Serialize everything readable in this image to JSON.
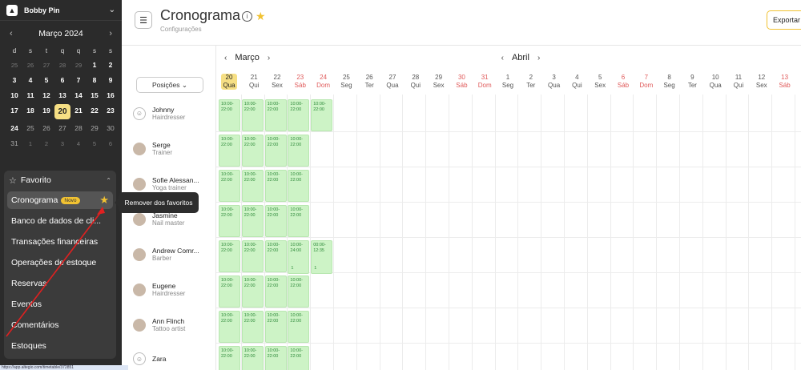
{
  "brand": {
    "name": "Bobby Pin",
    "logo_letter": "▲"
  },
  "calendar": {
    "month": "Março 2024",
    "prev": "‹",
    "next": "›",
    "dow": [
      "d",
      "s",
      "t",
      "q",
      "q",
      "s",
      "s"
    ],
    "weeks": [
      [
        {
          "d": "25",
          "m": 1
        },
        {
          "d": "26",
          "m": 1
        },
        {
          "d": "27",
          "m": 1
        },
        {
          "d": "28",
          "m": 1
        },
        {
          "d": "29",
          "m": 1
        },
        {
          "d": "1",
          "m": 0
        },
        {
          "d": "2",
          "m": 0
        }
      ],
      [
        {
          "d": "3",
          "m": 0
        },
        {
          "d": "4",
          "m": 0
        },
        {
          "d": "5",
          "m": 0
        },
        {
          "d": "6",
          "m": 0
        },
        {
          "d": "7",
          "m": 0
        },
        {
          "d": "8",
          "m": 0
        },
        {
          "d": "9",
          "m": 0
        }
      ],
      [
        {
          "d": "10",
          "m": 0
        },
        {
          "d": "11",
          "m": 0
        },
        {
          "d": "12",
          "m": 0
        },
        {
          "d": "13",
          "m": 0
        },
        {
          "d": "14",
          "m": 0
        },
        {
          "d": "15",
          "m": 0
        },
        {
          "d": "16",
          "m": 0
        }
      ],
      [
        {
          "d": "17",
          "m": 0
        },
        {
          "d": "18",
          "m": 0
        },
        {
          "d": "19",
          "m": 0
        },
        {
          "d": "20",
          "m": 2
        },
        {
          "d": "21",
          "m": 0
        },
        {
          "d": "22",
          "m": 0
        },
        {
          "d": "23",
          "m": 0
        }
      ],
      [
        {
          "d": "24",
          "m": 0
        },
        {
          "d": "25",
          "m": 3
        },
        {
          "d": "26",
          "m": 3
        },
        {
          "d": "27",
          "m": 3
        },
        {
          "d": "28",
          "m": 3
        },
        {
          "d": "29",
          "m": 3
        },
        {
          "d": "30",
          "m": 3
        }
      ],
      [
        {
          "d": "31",
          "m": 3
        },
        {
          "d": "1",
          "m": 1
        },
        {
          "d": "2",
          "m": 1
        },
        {
          "d": "3",
          "m": 1
        },
        {
          "d": "4",
          "m": 1
        },
        {
          "d": "5",
          "m": 1
        },
        {
          "d": "6",
          "m": 1
        }
      ]
    ]
  },
  "favorites": {
    "title": "Favorito",
    "items": [
      {
        "label": "Cronograma",
        "badge": "Novo",
        "active": true
      },
      {
        "label": "Banco de dados de cli..."
      },
      {
        "label": "Transações financeiras"
      },
      {
        "label": "Operações de estoque"
      },
      {
        "label": "Reservas"
      },
      {
        "label": "Eventos"
      },
      {
        "label": "Comentários"
      },
      {
        "label": "Estoques"
      }
    ]
  },
  "tooltip": "Remover dos favoritos",
  "header": {
    "title": "Cronograma",
    "subtitle": "Configurações",
    "export": "Exportar",
    "menu_icon": "☰"
  },
  "schedule": {
    "filter": "Posições",
    "months": [
      {
        "label": "Março",
        "col": 0
      },
      {
        "label": "Abril",
        "col": 12
      }
    ],
    "days": [
      {
        "n": "20",
        "w": "Qua",
        "t": "today"
      },
      {
        "n": "21",
        "w": "Qui",
        "t": "normal"
      },
      {
        "n": "22",
        "w": "Sex",
        "t": "normal"
      },
      {
        "n": "23",
        "w": "Sáb",
        "t": "weekend"
      },
      {
        "n": "24",
        "w": "Dom",
        "t": "weekend"
      },
      {
        "n": "25",
        "w": "Seg",
        "t": "normal"
      },
      {
        "n": "26",
        "w": "Ter",
        "t": "normal"
      },
      {
        "n": "27",
        "w": "Qua",
        "t": "normal"
      },
      {
        "n": "28",
        "w": "Qui",
        "t": "normal"
      },
      {
        "n": "29",
        "w": "Sex",
        "t": "normal"
      },
      {
        "n": "30",
        "w": "Sáb",
        "t": "weekend"
      },
      {
        "n": "31",
        "w": "Dom",
        "t": "weekend"
      },
      {
        "n": "1",
        "w": "Seg",
        "t": "normal"
      },
      {
        "n": "2",
        "w": "Ter",
        "t": "normal"
      },
      {
        "n": "3",
        "w": "Qua",
        "t": "normal"
      },
      {
        "n": "4",
        "w": "Qui",
        "t": "normal"
      },
      {
        "n": "5",
        "w": "Sex",
        "t": "normal"
      },
      {
        "n": "6",
        "w": "Sáb",
        "t": "weekend"
      },
      {
        "n": "7",
        "w": "Dom",
        "t": "weekend"
      },
      {
        "n": "8",
        "w": "Seg",
        "t": "normal"
      },
      {
        "n": "9",
        "w": "Ter",
        "t": "normal"
      },
      {
        "n": "10",
        "w": "Qua",
        "t": "normal"
      },
      {
        "n": "11",
        "w": "Qui",
        "t": "normal"
      },
      {
        "n": "12",
        "w": "Sex",
        "t": "normal"
      },
      {
        "n": "13",
        "w": "Sáb",
        "t": "weekend"
      }
    ],
    "staff": [
      {
        "name": "Johnny",
        "role": "Hairdresser",
        "avatar": "empty",
        "shifts": [
          {
            "c": 0,
            "t": "10:00-\n22:00"
          },
          {
            "c": 1,
            "t": "10:00-\n22:00"
          },
          {
            "c": 2,
            "t": "10:00-\n22:00"
          },
          {
            "c": 3,
            "t": "10:00-\n22:00"
          },
          {
            "c": 4,
            "t": "10:00-\n22:00"
          }
        ]
      },
      {
        "name": "Serge",
        "role": "Trainer",
        "avatar": "photo",
        "shifts": [
          {
            "c": 0,
            "t": "10:00-\n22:00"
          },
          {
            "c": 1,
            "t": "10:00-\n22:00"
          },
          {
            "c": 2,
            "t": "10:00-\n22:00"
          },
          {
            "c": 3,
            "t": "10:00-\n22:00"
          }
        ]
      },
      {
        "name": "Sofie Alessan...",
        "role": "Yoga trainer",
        "avatar": "photo",
        "shifts": [
          {
            "c": 0,
            "t": "10:00-\n22:00"
          },
          {
            "c": 1,
            "t": "10:00-\n22:00"
          },
          {
            "c": 2,
            "t": "10:00-\n22:00"
          },
          {
            "c": 3,
            "t": "10:00-\n22:00"
          }
        ]
      },
      {
        "name": "Jasmine",
        "role": "Nail master",
        "avatar": "photo",
        "shifts": [
          {
            "c": 0,
            "t": "10:00-\n22:00"
          },
          {
            "c": 1,
            "t": "10:00-\n22:00"
          },
          {
            "c": 2,
            "t": "10:00-\n22:00"
          },
          {
            "c": 3,
            "t": "10:00-\n22:00"
          }
        ]
      },
      {
        "name": "Andrew Comr...",
        "role": "Barber",
        "avatar": "photo",
        "shifts": [
          {
            "c": 0,
            "t": "10:00-\n22:00"
          },
          {
            "c": 1,
            "t": "10:00-\n22:00"
          },
          {
            "c": 2,
            "t": "10:00-\n22:00"
          },
          {
            "c": 3,
            "t": "10:00-\n24:00",
            "n": "1"
          },
          {
            "c": 4,
            "t": "00:00-\n12:35",
            "n": "1"
          }
        ]
      },
      {
        "name": "Eugene",
        "role": "Hairdresser",
        "avatar": "photo",
        "shifts": [
          {
            "c": 0,
            "t": "10:00-\n22:00"
          },
          {
            "c": 1,
            "t": "10:00-\n22:00"
          },
          {
            "c": 2,
            "t": "10:00-\n22:00"
          },
          {
            "c": 3,
            "t": "10:00-\n22:00"
          }
        ]
      },
      {
        "name": "Ann Flinch",
        "role": "Tattoo artist",
        "avatar": "photo",
        "shifts": [
          {
            "c": 0,
            "t": "10:00-\n22:00"
          },
          {
            "c": 1,
            "t": "10:00-\n22:00"
          },
          {
            "c": 2,
            "t": "10:00-\n22:00"
          },
          {
            "c": 3,
            "t": "10:00-\n22:00"
          }
        ]
      },
      {
        "name": "Zara",
        "role": "",
        "avatar": "empty",
        "shifts": [
          {
            "c": 0,
            "t": "10:00-\n22:00"
          },
          {
            "c": 1,
            "t": "10:00-\n22:00"
          },
          {
            "c": 2,
            "t": "10:00-\n22:00"
          },
          {
            "c": 3,
            "t": "10:00-\n22:00"
          }
        ]
      }
    ]
  },
  "status_url": "https://app.altegio.com/timetable/372851"
}
